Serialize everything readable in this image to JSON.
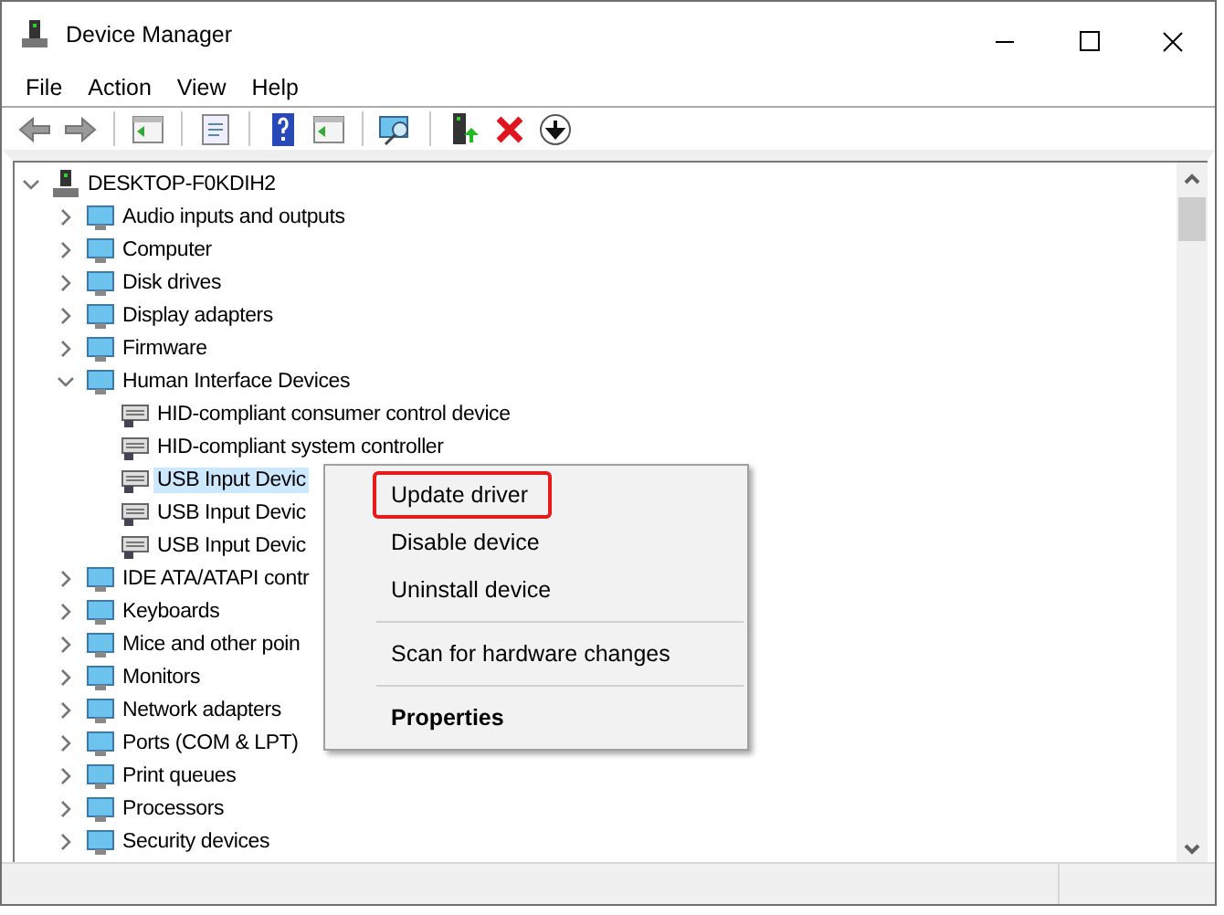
{
  "window": {
    "title": "Device Manager"
  },
  "menu_bar": [
    "File",
    "Action",
    "View",
    "Help"
  ],
  "tree": [
    {
      "label": "DESKTOP-F0KDIH2",
      "expanded": true,
      "selected": false,
      "children": [
        {
          "label": "Audio inputs and outputs",
          "expanded": false,
          "selected": false
        },
        {
          "label": "Computer",
          "expanded": false,
          "selected": false
        },
        {
          "label": "Disk drives",
          "expanded": false,
          "selected": false
        },
        {
          "label": "Display adapters",
          "expanded": false,
          "selected": false
        },
        {
          "label": "Firmware",
          "expanded": false,
          "selected": false
        },
        {
          "label": "Human Interface Devices",
          "expanded": true,
          "selected": false,
          "children": [
            {
              "label": "HID-compliant consumer control device",
              "selected": false
            },
            {
              "label": "HID-compliant system controller",
              "selected": false
            },
            {
              "label": "USB Input Devic",
              "selected": true
            },
            {
              "label": "USB Input Devic",
              "selected": false
            },
            {
              "label": "USB Input Devic",
              "selected": false
            }
          ]
        },
        {
          "label": "IDE ATA/ATAPI contr",
          "expanded": false,
          "selected": false
        },
        {
          "label": "Keyboards",
          "expanded": false,
          "selected": false
        },
        {
          "label": "Mice and other poin",
          "expanded": false,
          "selected": false
        },
        {
          "label": "Monitors",
          "expanded": false,
          "selected": false
        },
        {
          "label": "Network adapters",
          "expanded": false,
          "selected": false
        },
        {
          "label": "Ports (COM & LPT)",
          "expanded": false,
          "selected": false
        },
        {
          "label": "Print queues",
          "expanded": false,
          "selected": false
        },
        {
          "label": "Processors",
          "expanded": false,
          "selected": false
        },
        {
          "label": "Security devices",
          "expanded": false,
          "selected": false
        }
      ]
    }
  ],
  "context_menu": [
    {
      "label": "Update driver",
      "highlighted": true,
      "separator_before": false,
      "bold": false
    },
    {
      "label": "Disable device",
      "highlighted": false,
      "separator_before": false,
      "bold": false
    },
    {
      "label": "Uninstall device",
      "highlighted": false,
      "separator_before": false,
      "bold": false
    },
    {
      "label": "Scan for hardware changes",
      "highlighted": false,
      "separator_before": true,
      "bold": false
    },
    {
      "label": "Properties",
      "highlighted": false,
      "separator_before": true,
      "bold": true
    }
  ]
}
